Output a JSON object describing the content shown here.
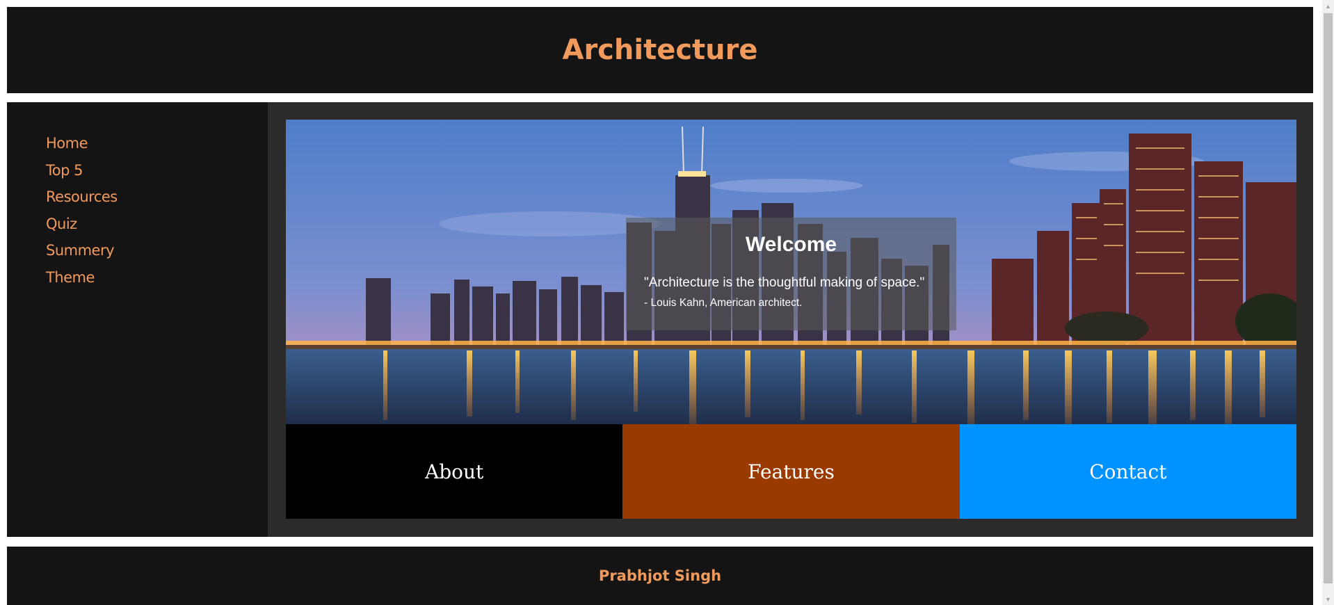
{
  "header": {
    "title": "Architecture"
  },
  "sidebar": {
    "items": [
      {
        "label": "Home"
      },
      {
        "label": "Top 5"
      },
      {
        "label": "Resources"
      },
      {
        "label": "Quiz"
      },
      {
        "label": "Summery"
      },
      {
        "label": "Theme"
      }
    ]
  },
  "hero": {
    "image": "city-skyline-at-night-over-water",
    "welcome_title": "Welcome",
    "quote": "\"Architecture is the thoughtful making of space.\"",
    "author": "- Louis Kahn, American architect."
  },
  "tiles": [
    {
      "label": "About",
      "color": "#000000"
    },
    {
      "label": "Features",
      "color": "#993a00"
    },
    {
      "label": "Contact",
      "color": "#0092ff"
    }
  ],
  "footer": {
    "name": "Prabhjot Singh"
  },
  "colors": {
    "accent": "#f29a5c",
    "panel": "#141414",
    "content_bg": "#2b2b2b"
  }
}
